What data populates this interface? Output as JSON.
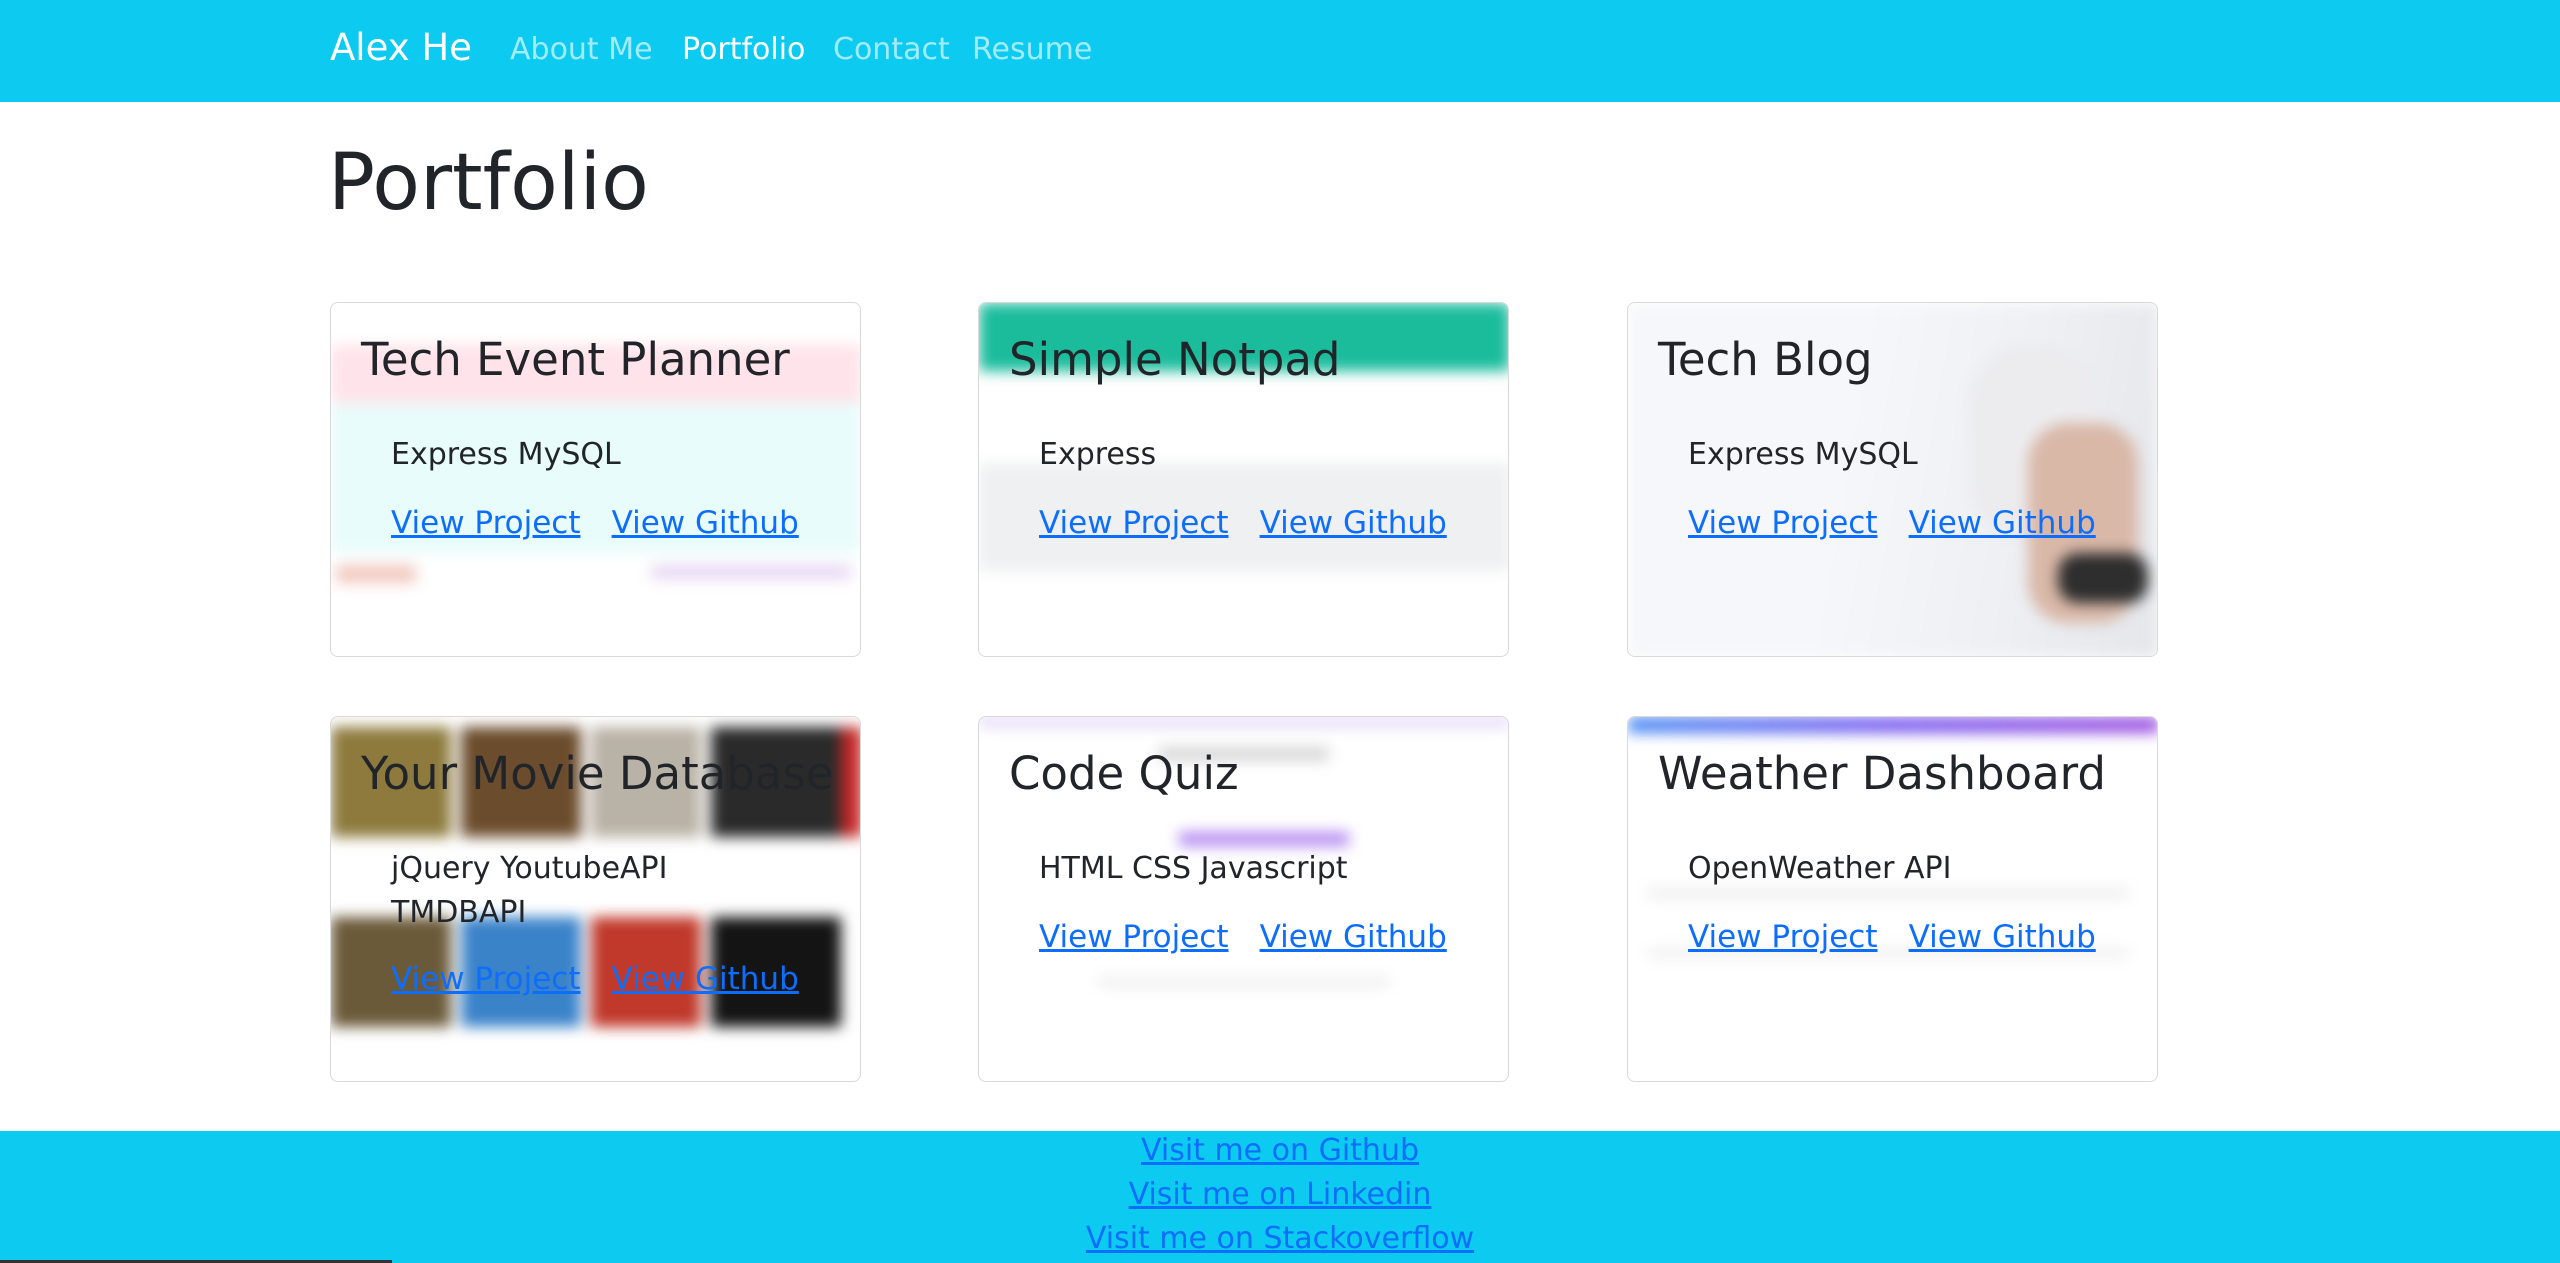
{
  "navbar": {
    "brand": "Alex He",
    "links": [
      {
        "label": "About Me",
        "active": false
      },
      {
        "label": "Portfolio",
        "active": true
      },
      {
        "label": "Contact",
        "active": false
      },
      {
        "label": "Resume",
        "active": false
      }
    ]
  },
  "page_title": "Portfolio",
  "projects": [
    {
      "title": "Tech Event Planner",
      "tech": "Express MySQL",
      "view_project": "View Project",
      "view_github": "View Github"
    },
    {
      "title": "Simple Notpad",
      "tech": "Express",
      "view_project": "View Project",
      "view_github": "View Github"
    },
    {
      "title": "Tech Blog",
      "tech": "Express MySQL",
      "view_project": "View Project",
      "view_github": "View Github"
    },
    {
      "title": "Your Movie Database",
      "tech": "jQuery YoutubeAPI TMDBAPI",
      "view_project": "View Project",
      "view_github": "View Github"
    },
    {
      "title": "Code Quiz",
      "tech": "HTML CSS Javascript",
      "view_project": "View Project",
      "view_github": "View Github"
    },
    {
      "title": "Weather Dashboard",
      "tech": "OpenWeather API",
      "view_project": "View Project",
      "view_github": "View Github"
    }
  ],
  "footer": {
    "github": "Visit me on Github",
    "linkedin": "Visit me on Linkedin",
    "stackoverflow": "Visit me on Stackoverflow"
  },
  "colors": {
    "navbar_bg": "#0dcaf0",
    "footer_bg": "#0dcaf0",
    "link": "#0d6efd",
    "text": "#212529"
  }
}
